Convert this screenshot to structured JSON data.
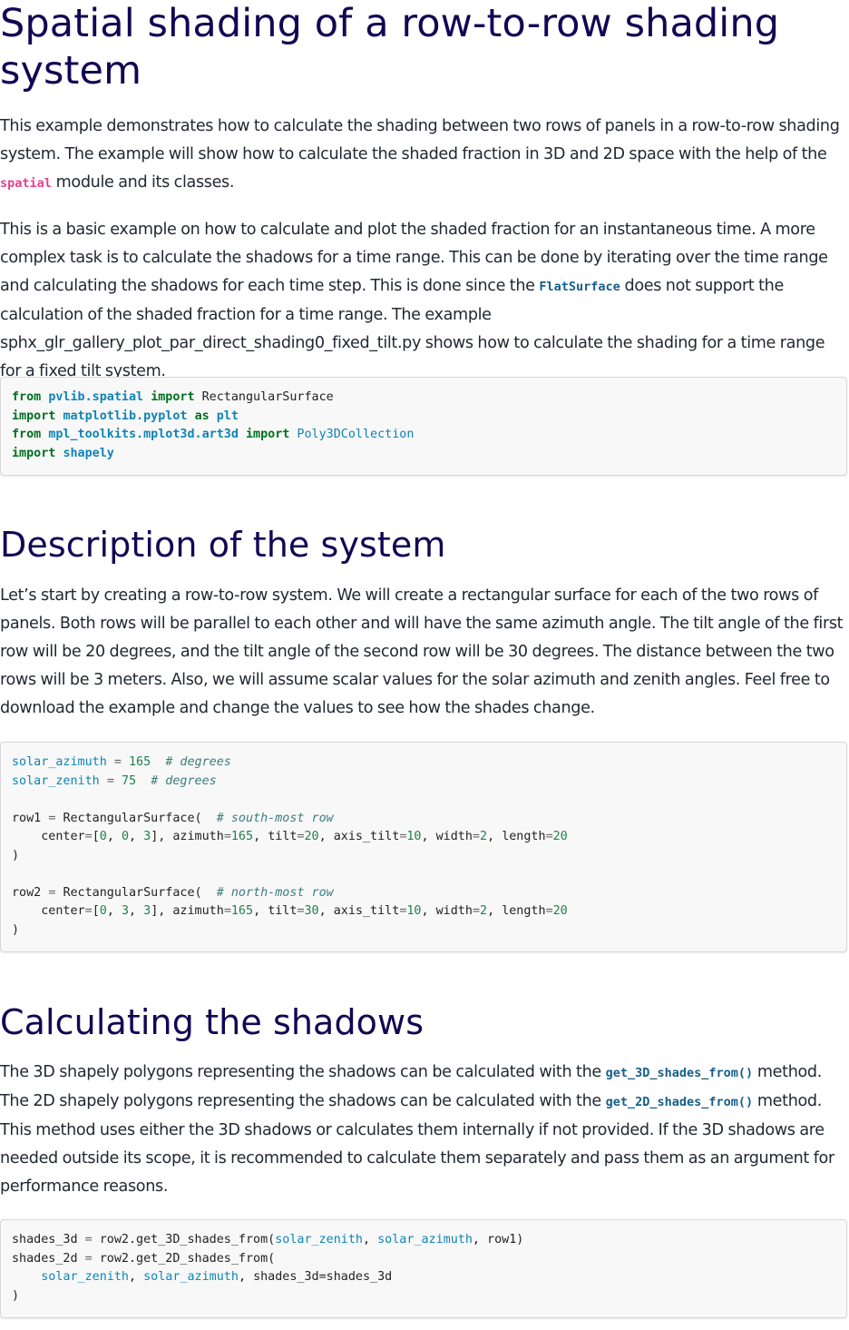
{
  "title": "Spatial shading of a row-to-row shading system",
  "intro": {
    "p1_before": "This example demonstrates how to calculate the shading between two rows of panels in a row-to-row shading system. The example will show how to calculate the shaded fraction in 3D and 2D space with the help of the ",
    "p1_code": "spatial",
    "p1_after": " module and its classes.",
    "p2_before": "This is a basic example on how to calculate and plot the shaded fraction for an instantaneous time. A more complex task is to calculate the shadows for a time range. This can be done by iterating over the time range and calculating the shadows for each time step. This is done since the ",
    "p2_code": "FlatSurface",
    "p2_after": " does not support the calculation of the shaded fraction for a time range. The example sphx_glr_gallery_plot_par_direct_shading0_fixed_tilt.py shows how to calculate the shading for a time range for a fixed tilt system."
  },
  "code1": {
    "line1": {
      "kw1": "from",
      "mod": "pvlib.spatial",
      "kw2": "import",
      "name": "RectangularSurface"
    },
    "line2": {
      "kw1": "import",
      "mod": "matplotlib.pyplot",
      "kw2": "as",
      "name": "plt"
    },
    "line3": {
      "kw1": "from",
      "mod": "mpl_toolkits.mplot3d.art3d",
      "kw2": "import",
      "name": "Poly3DCollection"
    },
    "line4": {
      "kw1": "import",
      "mod": "shapely"
    }
  },
  "section1": {
    "heading": "Description of the system",
    "text": "Let’s start by creating a row-to-row system. We will create a rectangular surface for each of the two rows of panels. Both rows will be parallel to each other and will have the same azimuth angle. The tilt angle of the first row will be 20 degrees, and the tilt angle of the second row will be 30 degrees. The distance between the two rows will be 3 meters. Also, we will assume scalar values for the solar azimuth and zenith angles. Feel free to download the example and change the values to see how the shades change."
  },
  "code2": {
    "l1_var": "solar_azimuth",
    "l1_val": "165",
    "l1_comment": "# degrees",
    "l2_var": "solar_zenith",
    "l2_val": "75",
    "l2_comment": "# degrees",
    "row1_var": "row1",
    "row1_cls": "RectangularSurface(",
    "row1_comment": "# south-most row",
    "row1_center": [
      "0",
      "0",
      "3"
    ],
    "row1_azimuth": "165",
    "row1_tilt": "20",
    "row1_axis_tilt": "10",
    "row1_width": "2",
    "row1_length": "20",
    "row2_var": "row2",
    "row2_cls": "RectangularSurface(",
    "row2_comment": "# north-most row",
    "row2_center": [
      "0",
      "3",
      "3"
    ],
    "row2_azimuth": "165",
    "row2_tilt": "30",
    "row2_axis_tilt": "10",
    "row2_width": "2",
    "row2_length": "20",
    "close_paren": ")"
  },
  "section2": {
    "heading": "Calculating the shadows",
    "t1": "The 3D shapely polygons representing the shadows can be calculated with the ",
    "c1": "get_3D_shades_from()",
    "t2": " method. The 2D shapely polygons representing the shadows can be calculated with the ",
    "c2": "get_2D_shades_from()",
    "t3": " method. This method uses either the 3D shadows or calculates them internally if not provided. If the 3D shadows are needed outside its scope, it is recommended to calculate them separately and pass them as an argument for performance reasons."
  },
  "code3": {
    "l1_var": "shades_3d",
    "l1_call": "row2.get_3D_shades_from(",
    "l1_arg1": "solar_zenith",
    "l1_arg2": "solar_azimuth",
    "l1_arg3": "row1)",
    "l2_var": "shades_2d",
    "l2_call": "row2.get_2D_shades_from(",
    "l3_arg1": "solar_zenith",
    "l3_arg2": "solar_azimuth",
    "l3_kw": "shades_3d=shades_3d",
    "l4": ")"
  }
}
